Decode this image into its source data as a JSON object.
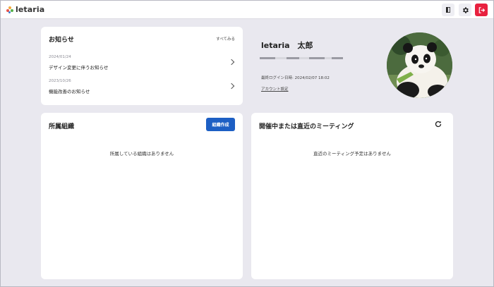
{
  "app": {
    "name": "letaria",
    "colors": {
      "background": "#e9e8ef",
      "accent": "#1d5fc4",
      "logout": "#e8213f"
    },
    "icons": {
      "door": "door-icon",
      "settings": "gear-icon",
      "logout": "logout-icon"
    }
  },
  "news": {
    "title": "お知らせ",
    "see_all": "すべてみる",
    "items": [
      {
        "date": "2024/01/24",
        "title": "デザイン変更に伴うお知らせ"
      },
      {
        "date": "2023/10/26",
        "title": "機能改善のお知らせ"
      }
    ]
  },
  "profile": {
    "name": "letaria　太郎",
    "last_login": "最終ログイン日時: 2024/02/07 18:02",
    "account_settings": "アカウント設定"
  },
  "orgs": {
    "title": "所属組織",
    "create_button": "組織作成",
    "empty": "所属している組織はありません"
  },
  "meetings": {
    "title": "開催中または直近のミーティング",
    "empty": "直近のミーティング予定はありません"
  }
}
